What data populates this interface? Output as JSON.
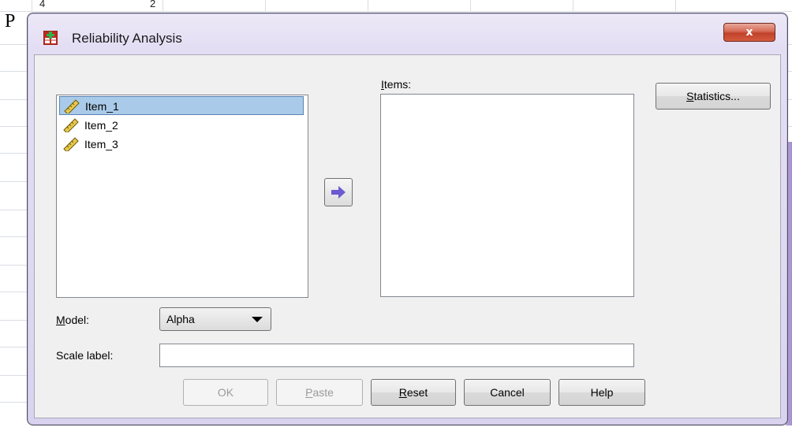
{
  "background": {
    "cell_values": [
      "4",
      "2"
    ],
    "left_letter": "P"
  },
  "window": {
    "title": "Reliability Analysis",
    "close_glyph": "x",
    "close_color": "#c94a33"
  },
  "variables": {
    "items": [
      {
        "label": "Item_1",
        "selected": true
      },
      {
        "label": "Item_2",
        "selected": false
      },
      {
        "label": "Item_3",
        "selected": false
      }
    ],
    "icon": "ruler-scale-icon"
  },
  "items_panel": {
    "label_first": "I",
    "label_rest": "tems:"
  },
  "move_button": {
    "icon": "arrow-right-icon",
    "color": "#6b5bd1"
  },
  "statistics_button": {
    "mnemonic": "S",
    "rest": "tatistics..."
  },
  "model": {
    "label_first": "M",
    "label_rest": "odel:",
    "selected": "Alpha"
  },
  "scale_label": {
    "label": "Scale label:",
    "value": ""
  },
  "buttons": {
    "ok": "OK",
    "paste_mnemonic": "P",
    "paste_rest": "aste",
    "reset_mnemonic": "R",
    "reset_rest": "eset",
    "cancel": "Cancel",
    "help": "Help"
  }
}
